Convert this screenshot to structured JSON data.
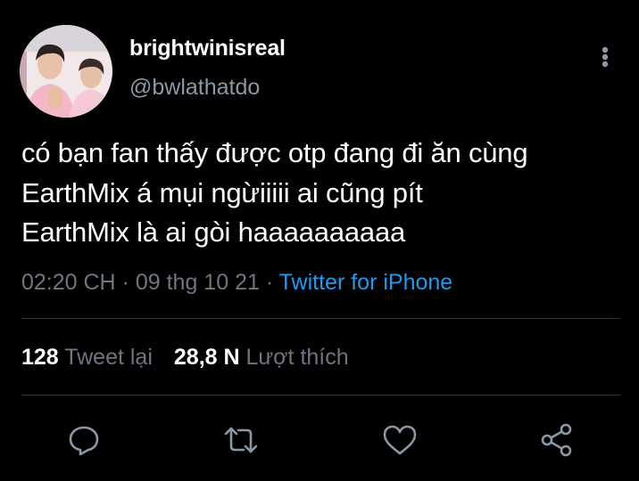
{
  "user": {
    "display_name": "brightwinisreal",
    "handle": "@bwlathatdo"
  },
  "tweet": {
    "lines": [
      "có bạn fan thấy được otp đang đi ăn cùng",
      "EarthMix á mụi ngừiiiii ai cũng pít",
      "EarthMix là ai gòi haaaaaaaaaa"
    ]
  },
  "meta": {
    "time": "02:20 CH",
    "separator": "·",
    "date": "09 thg 10 21",
    "source": "Twitter for iPhone"
  },
  "stats": {
    "retweets_count": "128",
    "retweets_label": "Tweet lại",
    "likes_count": "28,8 N",
    "likes_label": "Lượt thích"
  },
  "actions": [
    {
      "icon": "reply-icon"
    },
    {
      "icon": "retweet-icon"
    },
    {
      "icon": "like-icon"
    },
    {
      "icon": "share-icon"
    }
  ],
  "colors": {
    "background": "#000000",
    "text": "#ffffff",
    "secondary": "#8b98a5",
    "link": "#1d9bf0",
    "divider": "#2f3336"
  }
}
